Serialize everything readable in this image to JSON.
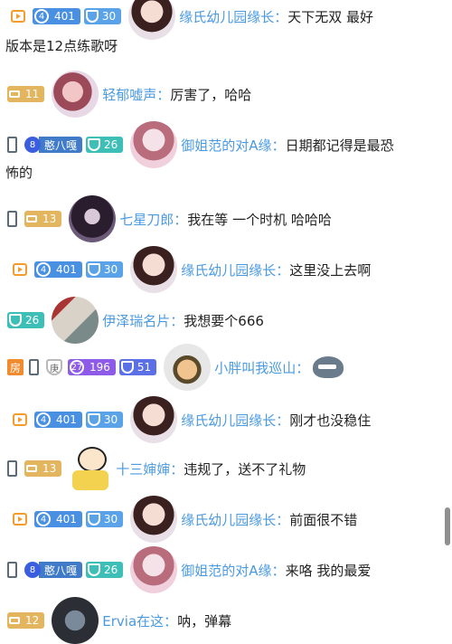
{
  "messages": [
    {
      "badges": [
        "live"
      ],
      "level": {
        "num": "4",
        "value": "401"
      },
      "fan": {
        "value": "30"
      },
      "avatar": "girl",
      "name": "缘氏幼儿园缘长：",
      "text_line1": "天下无双 最好",
      "text_line2": "版本是12点练歌呀"
    },
    {
      "badges": [],
      "gold": "11",
      "avatar": "anime1",
      "name": "轻郁嘘声：",
      "text_line1": "厉害了，哈哈"
    },
    {
      "badges": [
        "phone"
      ],
      "seal": {
        "num": "8",
        "label": "憨八嘎"
      },
      "fan": {
        "value": "26"
      },
      "avatar": "anime2",
      "name": "御姐范的对A缘：",
      "text_line1": "日期都记得是最恐",
      "text_line2": "怖的"
    },
    {
      "badges": [
        "phone"
      ],
      "gold": "13",
      "avatar": "dark",
      "name": "七星刀郎：",
      "text_line1": "我在等 一个时机 哈哈哈"
    },
    {
      "badges": [
        "live"
      ],
      "level": {
        "num": "4",
        "value": "401"
      },
      "fan": {
        "value": "30"
      },
      "avatar": "girl",
      "name": "缘氏幼儿园缘长：",
      "text_line1": "这里没上去啊"
    },
    {
      "badges": [],
      "fan": {
        "value": "26"
      },
      "avatar": "rect",
      "name": "伊泽瑞名片：",
      "text_line1": "我想要个666"
    },
    {
      "badges": [
        "fang",
        "phone",
        "shield-gray"
      ],
      "fang": "房",
      "shield_text": "庚",
      "level": {
        "num": "27",
        "value": "196"
      },
      "fan": {
        "value": "51"
      },
      "avatar": "soldier",
      "name": "小胖叫我巡山：",
      "text_line1": ""
    },
    {
      "badges": [
        "live"
      ],
      "level": {
        "num": "4",
        "value": "401"
      },
      "fan": {
        "value": "30"
      },
      "avatar": "girl",
      "name": "缘氏幼儿园缘长：",
      "text_line1": "刚才也没稳住"
    },
    {
      "badges": [
        "phone"
      ],
      "gold": "13",
      "avatar": "cartoon",
      "name": "十三婶婶：",
      "text_line1": "违规了，送不了礼物"
    },
    {
      "badges": [
        "live"
      ],
      "level": {
        "num": "4",
        "value": "401"
      },
      "fan": {
        "value": "30"
      },
      "avatar": "girl",
      "name": "缘氏幼儿园缘长：",
      "text_line1": "前面很不错"
    },
    {
      "badges": [
        "phone"
      ],
      "seal": {
        "num": "8",
        "label": "憨八嘎"
      },
      "fan": {
        "value": "26"
      },
      "avatar": "anime2",
      "name": "御姐范的对A缘：",
      "text_line1": "来咯 我的最爱"
    },
    {
      "badges": [],
      "gold": "12",
      "avatar": "robot",
      "name": "Ervia在这：",
      "text_line1": "呐，弹幕"
    }
  ]
}
